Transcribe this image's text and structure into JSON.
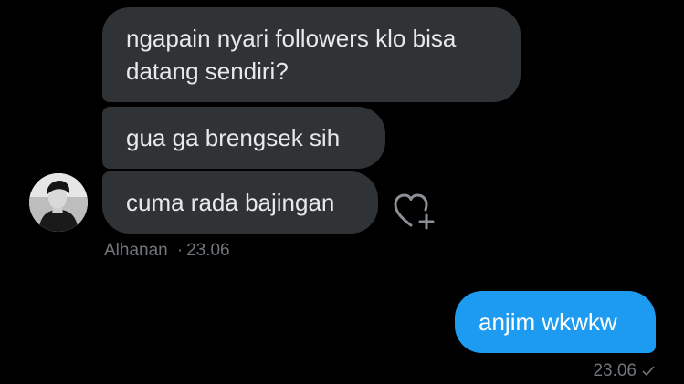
{
  "conversation": {
    "incoming": [
      {
        "text": "ngapain nyari followers klo bisa\ndatang sendiri?"
      },
      {
        "text": "gua ga brengsek sih"
      },
      {
        "text": "cuma rada bajingan"
      }
    ],
    "incoming_meta": {
      "sender": "Alhanan",
      "separator": "·",
      "time": "23.06"
    },
    "outgoing": {
      "text": "anjim wkwkw",
      "time": "23.06"
    }
  },
  "icons": {
    "avatar": "user-avatar-photo",
    "like": "heart-plus-icon",
    "sent": "checkmark-icon"
  },
  "colors": {
    "background": "#000000",
    "incoming_bubble": "#2f3336",
    "outgoing_bubble": "#1d9bf0",
    "meta_text": "#71767b"
  }
}
